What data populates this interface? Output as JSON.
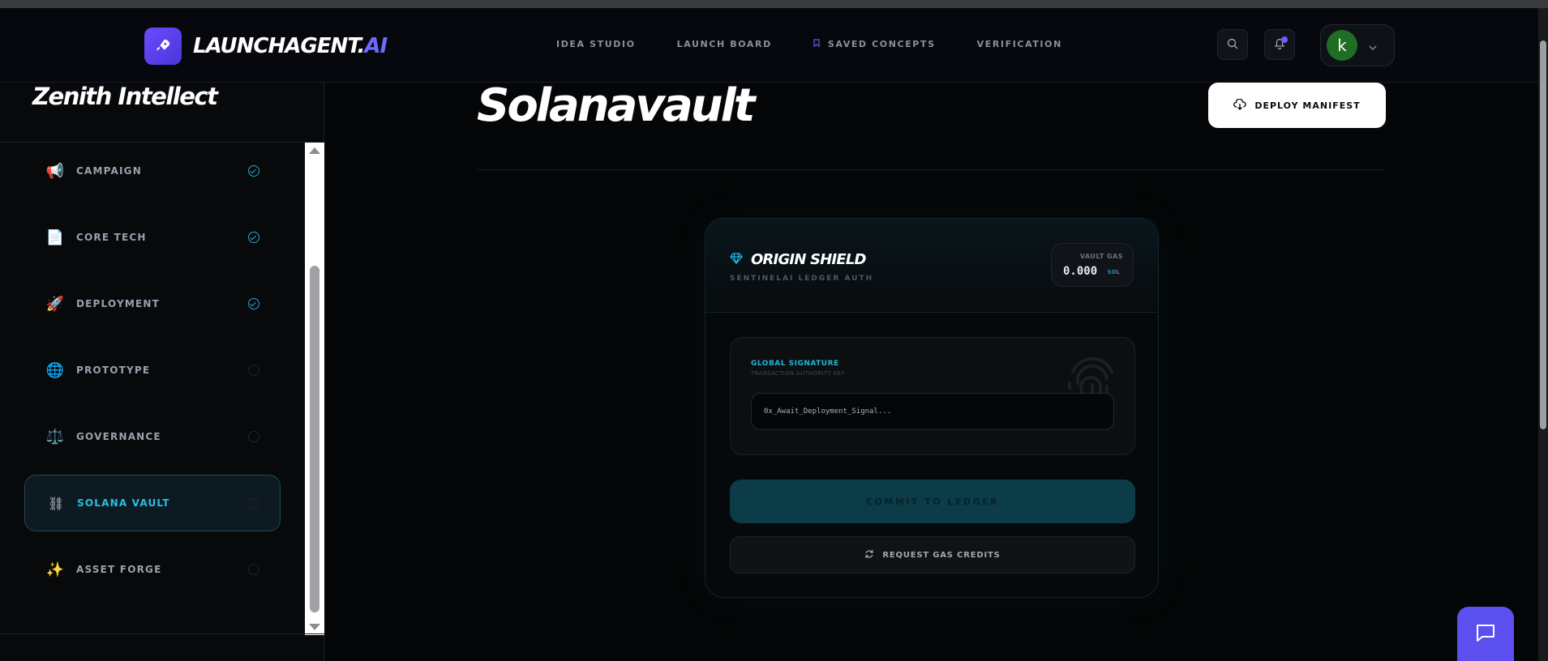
{
  "brand": {
    "name_main": "LAUNCHAGENT.",
    "name_accent": "AI"
  },
  "nav": [
    {
      "label": "IDEA STUDIO"
    },
    {
      "label": "LAUNCH BOARD"
    },
    {
      "label": "SAVED CONCEPTS"
    },
    {
      "label": "VERIFICATION"
    }
  ],
  "user": {
    "initial": "k"
  },
  "sidebar": {
    "project_name": "Zenith Intellect",
    "steps": [
      {
        "label": "CAMPAIGN",
        "icon": "📢",
        "status": "done"
      },
      {
        "label": "CORE TECH",
        "icon": "📄",
        "status": "done"
      },
      {
        "label": "DEPLOYMENT",
        "icon": "🚀",
        "status": "done"
      },
      {
        "label": "PROTOTYPE",
        "icon": "🌐",
        "status": "pending"
      },
      {
        "label": "GOVERNANCE",
        "icon": "⚖️",
        "status": "pending"
      },
      {
        "label": "SOLANA VAULT",
        "icon": "⛓",
        "status": "active"
      },
      {
        "label": "ASSET FORGE",
        "icon": "✨",
        "status": "pending"
      }
    ]
  },
  "main": {
    "title": "Solanavault",
    "deploy_label": "DEPLOY MANIFEST",
    "card": {
      "title": "ORIGIN SHIELD",
      "subtitle": "SENTINELAI LEDGER AUTH",
      "gas_label": "VAULT GAS",
      "gas_value": "0.000",
      "gas_unit": "SOL",
      "signature_title": "GLOBAL SIGNATURE",
      "signature_sub": "TRANSACTION AUTHORITY KEY",
      "signature_placeholder": "0x_Await_Deployment_Signal...",
      "commit_label": "COMMIT TO LEDGER",
      "request_label": "REQUEST GAS CREDITS"
    }
  },
  "colors": {
    "accent": "#5b4ff0",
    "cyan": "#22b7d8",
    "active_bg": "#0d1a22"
  }
}
